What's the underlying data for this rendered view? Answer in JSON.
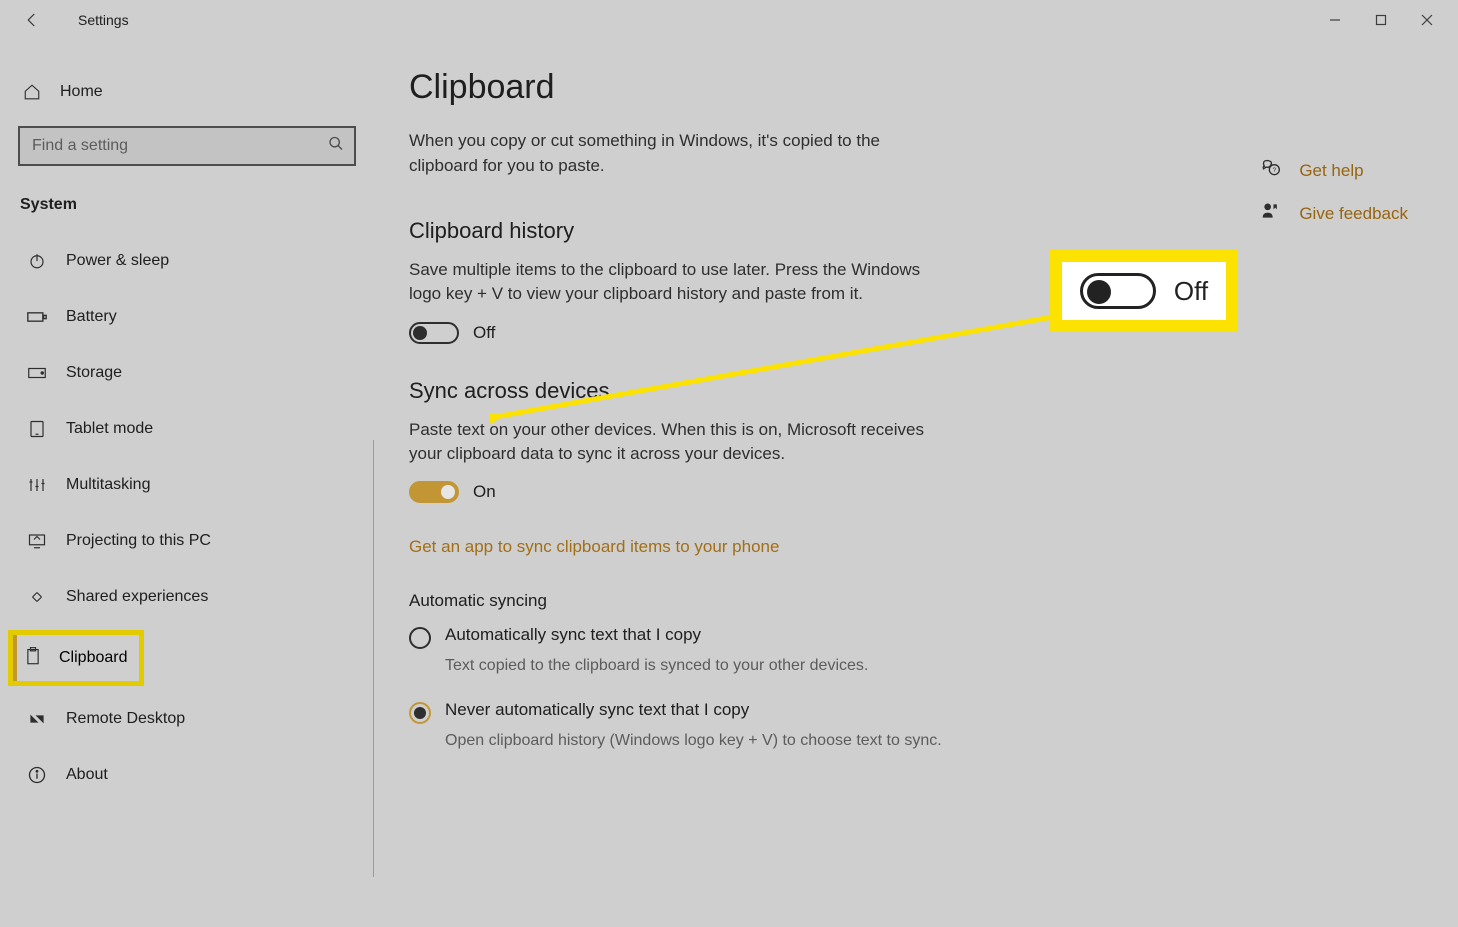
{
  "titlebar": {
    "title": "Settings"
  },
  "sidebar": {
    "home": "Home",
    "search_placeholder": "Find a setting",
    "section": "System",
    "items": [
      {
        "label": "Power & sleep",
        "icon": "power"
      },
      {
        "label": "Battery",
        "icon": "battery"
      },
      {
        "label": "Storage",
        "icon": "storage"
      },
      {
        "label": "Tablet mode",
        "icon": "tablet"
      },
      {
        "label": "Multitasking",
        "icon": "multitask"
      },
      {
        "label": "Projecting to this PC",
        "icon": "project"
      },
      {
        "label": "Shared experiences",
        "icon": "share"
      },
      {
        "label": "Clipboard",
        "icon": "clipboard",
        "selected": true
      },
      {
        "label": "Remote Desktop",
        "icon": "remote"
      },
      {
        "label": "About",
        "icon": "about"
      }
    ]
  },
  "main": {
    "title": "Clipboard",
    "lead": "When you copy or cut something in Windows, it's copied to the clipboard for you to paste.",
    "history": {
      "header": "Clipboard history",
      "desc": "Save multiple items to the clipboard to use later. Press the Windows logo key + V to view your clipboard history and paste from it.",
      "state": "Off"
    },
    "sync": {
      "header": "Sync across devices",
      "desc": "Paste text on your other devices. When this is on, Microsoft receives your clipboard data to sync it across your devices.",
      "state": "On",
      "app_link": "Get an app to sync clipboard items to your phone",
      "auto_header": "Automatic syncing",
      "radios": [
        {
          "label": "Automatically sync text that I copy",
          "sub": "Text copied to the clipboard is synced to your other devices.",
          "selected": false
        },
        {
          "label": "Never automatically sync text that I copy",
          "sub": "Open clipboard history (Windows logo key + V) to choose text to sync.",
          "selected": true
        }
      ]
    }
  },
  "help": {
    "get_help": "Get help",
    "feedback": "Give feedback"
  },
  "callout": {
    "label": "Off"
  }
}
